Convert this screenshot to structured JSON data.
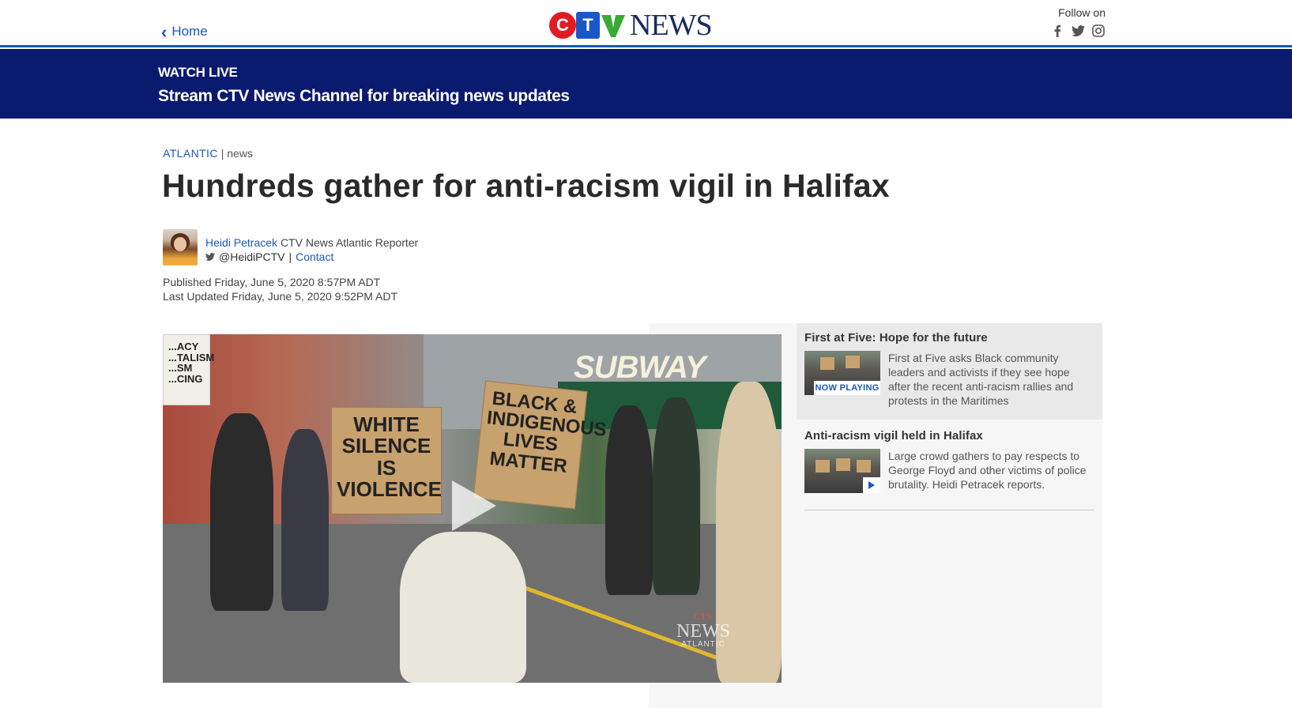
{
  "header": {
    "home_label": "Home",
    "logo": {
      "letters": [
        "C",
        "T",
        "V"
      ],
      "word": "NEWS"
    },
    "follow_label": "Follow on",
    "social_icons": [
      "facebook-icon",
      "twitter-icon",
      "instagram-icon"
    ]
  },
  "live_band": {
    "eyebrow": "WATCH LIVE",
    "headline": "Stream CTV News Channel for breaking news updates"
  },
  "article": {
    "section": "ATLANTIC",
    "separator": " | ",
    "subsection": "news",
    "headline": "Hundreds gather for anti-racism vigil in Halifax",
    "author": {
      "name": "Heidi Petracek",
      "role": "CTV News Atlantic Reporter",
      "handle": "@HeidiPCTV",
      "handle_sep": "|",
      "contact_label": "Contact"
    },
    "published": "Published Friday, June 5, 2020 8:57PM ADT",
    "updated": "Last Updated Friday, June 5, 2020 9:52PM ADT"
  },
  "video": {
    "sign_1": "WHITE SILENCE IS VIOLENCE",
    "sign_2": "BLACK & INDIGENOUS LIVES MATTER",
    "sign_3": "...ACY ...TALISM ...SM ...CING",
    "storefront": "SUBWAY",
    "watermark_ctv": "CTV",
    "watermark_news": "NEWS",
    "watermark_region": "ATLANTIC"
  },
  "playlist": [
    {
      "title": "First at Five: Hope for the future",
      "badge": "NOW PLAYING",
      "description": "First at Five asks Black community leaders and activists if they see hope after the recent anti-racism rallies and protests in the Maritimes"
    },
    {
      "title": "Anti-racism vigil held in Halifax",
      "description": "Large crowd gathers to pay respects to George Floyd and other victims of police brutality. Heidi Petracek reports."
    }
  ],
  "colors": {
    "brand_blue": "#1a56c8",
    "live_band": "#0a1a6e",
    "ctv_red": "#e21b23",
    "ctv_green": "#3aa935"
  }
}
